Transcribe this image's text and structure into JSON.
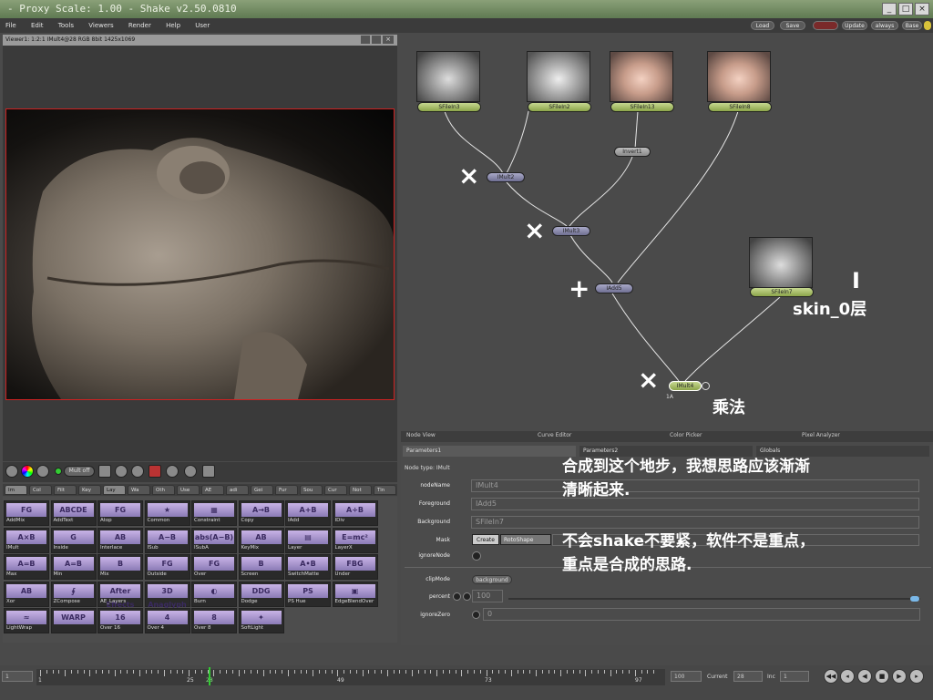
{
  "window": {
    "title": "- Proxy Scale: 1.00 - Shake v2.50.0810"
  },
  "menu": [
    "File",
    "Edit",
    "Tools",
    "Viewers",
    "Render",
    "Help",
    "User"
  ],
  "topbar": {
    "load": "Load",
    "save": "Save",
    "update": "Update",
    "always": "always",
    "base": "Base"
  },
  "viewer": {
    "header": "Viewer1: 1:2:1 IMult4@28 RGB 8bit 1425x1069",
    "toolbar": {
      "mult_off": "Mult off"
    }
  },
  "palette_tabs": [
    "Im",
    "Col",
    "Filt",
    "Key",
    "Lay",
    "Wa",
    "Oth",
    "Use",
    "AE",
    "adi",
    "Gei",
    "Fur",
    "Sou",
    "Cur",
    "Not",
    "Tin"
  ],
  "palette": [
    {
      "icon": "FG",
      "label": "AddMix"
    },
    {
      "icon": "ABCDE",
      "label": "AddText"
    },
    {
      "icon": "FG",
      "label": "Atop"
    },
    {
      "icon": "★",
      "label": "Common"
    },
    {
      "icon": "▦",
      "label": "Constraint"
    },
    {
      "icon": "A→B",
      "label": "Copy"
    },
    {
      "icon": "A+B",
      "label": "IAdd"
    },
    {
      "icon": "A÷B",
      "label": "IDiv"
    },
    {
      "icon": "A×B",
      "label": "IMult"
    },
    {
      "icon": "G",
      "label": "Inside"
    },
    {
      "icon": "AB",
      "label": "Interlace"
    },
    {
      "icon": "A−B",
      "label": "ISub"
    },
    {
      "icon": "abs(A−B)",
      "label": "ISubA"
    },
    {
      "icon": "AB",
      "label": "KeyMix"
    },
    {
      "icon": "▤",
      "label": "Layer"
    },
    {
      "icon": "E=mc²",
      "label": "LayerX"
    },
    {
      "icon": "A=B",
      "label": "Max"
    },
    {
      "icon": "A=B",
      "label": "Min"
    },
    {
      "icon": "B",
      "label": "Mix"
    },
    {
      "icon": "FG",
      "label": "Outside"
    },
    {
      "icon": "FG",
      "label": "Over"
    },
    {
      "icon": "B",
      "label": "Screen"
    },
    {
      "icon": "A•B",
      "label": "SwitchMatte"
    },
    {
      "icon": "FBG",
      "label": "Under"
    },
    {
      "icon": "AB",
      "label": "Xor"
    },
    {
      "icon": "∮",
      "label": "ZCompose"
    },
    {
      "icon": "After Effects",
      "label": "AE_Layers"
    },
    {
      "icon": "3D Anaglyph",
      "label": ""
    },
    {
      "icon": "◐",
      "label": "Burn"
    },
    {
      "icon": "DDG",
      "label": "Dodge"
    },
    {
      "icon": "PS",
      "label": "PS Hue"
    },
    {
      "icon": "▣",
      "label": "EdgeBlendOver"
    },
    {
      "icon": "≈",
      "label": "LightWrap"
    },
    {
      "icon": "WARP",
      "label": ""
    },
    {
      "icon": "16",
      "label": "Over 16"
    },
    {
      "icon": "4",
      "label": "Over 4"
    },
    {
      "icon": "8",
      "label": "Over 8"
    },
    {
      "icon": "✦",
      "label": "SoftLight"
    }
  ],
  "nodes": {
    "sfilein3": "SFileIn3",
    "sfilein2": "SFileIn2",
    "sfilein13": "SFileIn13",
    "sfilein8": "SFileIn8",
    "sfilein7": "SFileIn7",
    "invert1": "Invert1",
    "imult2": "IMult2",
    "imult3": "IMult3",
    "iadd5": "IAdd5",
    "imult4": "IMult4",
    "imult4_sub": "1A"
  },
  "annotations": {
    "mult_mark": "×",
    "add_mark": "+",
    "layer_bar": "I",
    "skin_label": "skin_0层",
    "multiply_label": "乘法",
    "note_line1": "合成到这个地步，我想思路应该渐渐",
    "note_line2": "清晰起来.",
    "note_line3": "不会shake不要紧，软件不是重点，",
    "note_line4": "重点是合成的思路."
  },
  "bottom_tabs": [
    "Node View",
    "Curve Editor",
    "Color Picker",
    "Pixel Analyzer"
  ],
  "param_tabs": [
    "Parameters1",
    "Parameters2",
    "Globals"
  ],
  "params": {
    "node_type": "Node type: IMult",
    "nodename_label": "nodeName",
    "nodename_value": "IMult4",
    "foreground_label": "Foreground",
    "foreground_value": "IAdd5",
    "background_label": "Background",
    "background_value": "SFileIn7",
    "mask_label": "Mask",
    "mask_create": "Create",
    "mask_roto": "RotoShape",
    "ignorenode_label": "ignoreNode",
    "clipmode_label": "clipMode",
    "clipmode_value": "background",
    "percent_label": "percent",
    "percent_value": "100",
    "ignorezero_label": "ignoreZero",
    "ignorezero_value": "0"
  },
  "timeline": {
    "start": "1",
    "ticks": [
      "1",
      "25",
      "28",
      "49",
      "73",
      "97"
    ],
    "end": "100",
    "current_label": "Current",
    "current_value": "28",
    "inc_label": "Inc",
    "inc_value": "1"
  }
}
